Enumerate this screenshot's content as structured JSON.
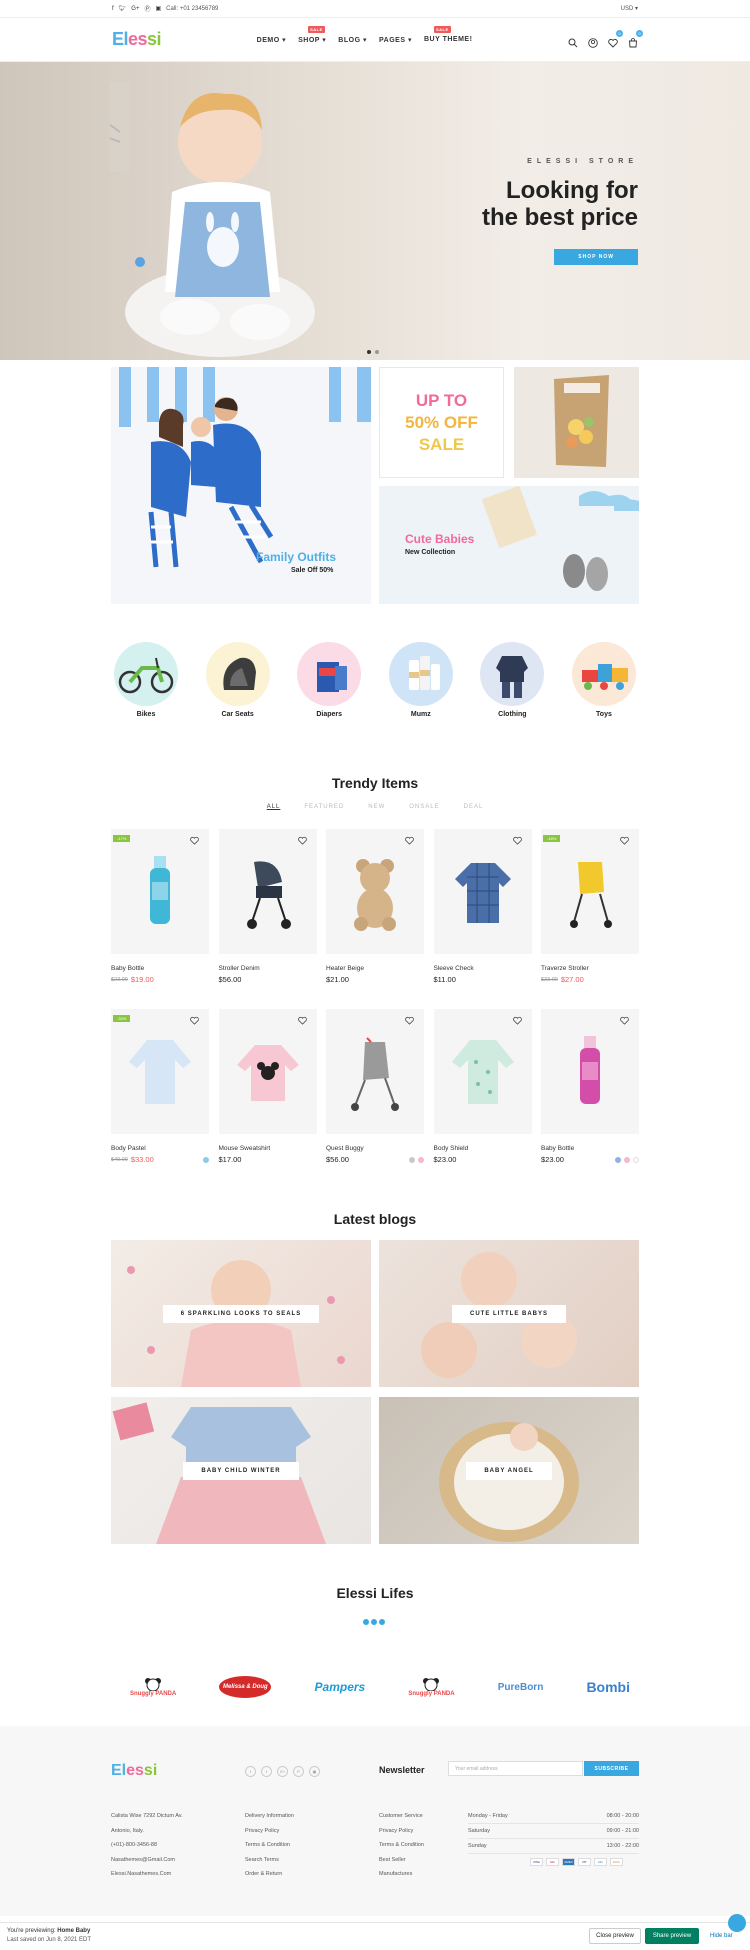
{
  "topbar": {
    "call": "Call: +01 23456789",
    "currency": "USD"
  },
  "header": {
    "logo": [
      "El",
      "es",
      "si"
    ],
    "nav": [
      {
        "label": "DEMO",
        "sale": ""
      },
      {
        "label": "SHOP",
        "sale": "SALE"
      },
      {
        "label": "BLOG",
        "sale": ""
      },
      {
        "label": "PAGES",
        "sale": ""
      },
      {
        "label": "BUY THEME!",
        "sale": "SALE"
      }
    ],
    "wishlist_count": "0",
    "cart_count": "0"
  },
  "hero": {
    "store": "ELESSI STORE",
    "title_line1": "Looking for",
    "title_line2": "the best price",
    "button": "SHOP NOW"
  },
  "banners": {
    "family_title": "Family Outfits",
    "family_sub": "Sale Off 50%",
    "sale_line1": "UP TO",
    "sale_line2": "50% OFF",
    "sale_line3": "SALE",
    "cute_title": "Cute Babies",
    "cute_sub": "New Collection"
  },
  "categories": [
    "Bikes",
    "Car Seats",
    "Diapers",
    "Mumz",
    "Clothing",
    "Toys"
  ],
  "trendy": {
    "title": "Trendy Items",
    "tabs": [
      "ALL",
      "FEATURED",
      "NEW",
      "ONSALE",
      "DEAL"
    ],
    "row1": [
      {
        "name": "Baby Bottle",
        "old": "$23.00",
        "price": "$19.00",
        "disc": "-17%"
      },
      {
        "name": "Stroller Denim",
        "old": "",
        "price": "$56.00",
        "disc": ""
      },
      {
        "name": "Heater Beige",
        "old": "",
        "price": "$21.00",
        "disc": ""
      },
      {
        "name": "Sleeve Check",
        "old": "",
        "price": "$11.00",
        "disc": ""
      },
      {
        "name": "Traverze Stroller",
        "old": "$33.00",
        "price": "$27.00",
        "disc": "-18%"
      }
    ],
    "row2": [
      {
        "name": "Body Pastel",
        "old": "$49.00",
        "price": "$33.00",
        "disc": "-33%"
      },
      {
        "name": "Mouse Sweatshirt",
        "old": "",
        "price": "$17.00",
        "disc": ""
      },
      {
        "name": "Quest Buggy",
        "old": "",
        "price": "$56.00",
        "disc": ""
      },
      {
        "name": "Body Shield",
        "old": "",
        "price": "$23.00",
        "disc": ""
      },
      {
        "name": "Baby Bottle",
        "old": "",
        "price": "$23.00",
        "disc": ""
      }
    ]
  },
  "blogs": {
    "title": "Latest blogs",
    "items": [
      "6 SPARKLING LOOKS TO SEALS",
      "CUTE LITTLE BABYS",
      "BABY CHILD WINTER",
      "BABY ANGEL"
    ]
  },
  "lifes": {
    "title": "Elessi Lifes"
  },
  "brands": [
    "Snuggly PANDA",
    "Melissa & Doug",
    "Pampers",
    "Snuggly PANDA",
    "PureBorn",
    "Bombi"
  ],
  "footer": {
    "newsletter_title": "Newsletter",
    "newsletter_placeholder": "Your email address",
    "subscribe": "SUBSCRIBE",
    "contact": [
      "Calista Wise 7292 Dictum Av.",
      "Antonio, Italy.",
      "(+01)-800-3456-88",
      "Nasathemes@Gmail.Com",
      "Elessi.Nasathemes.Com"
    ],
    "col2": [
      "Delivery Information",
      "Privacy Policy",
      "Terms & Condition",
      "Search Terms",
      "Order & Return"
    ],
    "col3": [
      "Customer Service",
      "Privacy Policy",
      "Terms & Condition",
      "Best Seller",
      "Manufactures"
    ],
    "hours": [
      {
        "day": "Monday - Friday",
        "time": "08:00 - 20:00"
      },
      {
        "day": "Saturday",
        "time": "09:00 - 21:00"
      },
      {
        "day": "Sunday",
        "time": "13:00 - 22:00"
      }
    ],
    "payments": [
      "VISA",
      "MC",
      "AMEX",
      "PP",
      "DC",
      "DISC"
    ]
  },
  "preview_bar": {
    "line1_prefix": "You're previewing:",
    "line1_theme": "Home Baby",
    "line2": "Last saved on Jun 8, 2021 EDT",
    "close": "Close preview",
    "share": "Share preview",
    "hide": "Hide bar"
  },
  "colors": {
    "accent": "#3aa8e0",
    "sale": "#ef5b5b",
    "green": "#8ac53f",
    "pink": "#f06a9b"
  }
}
